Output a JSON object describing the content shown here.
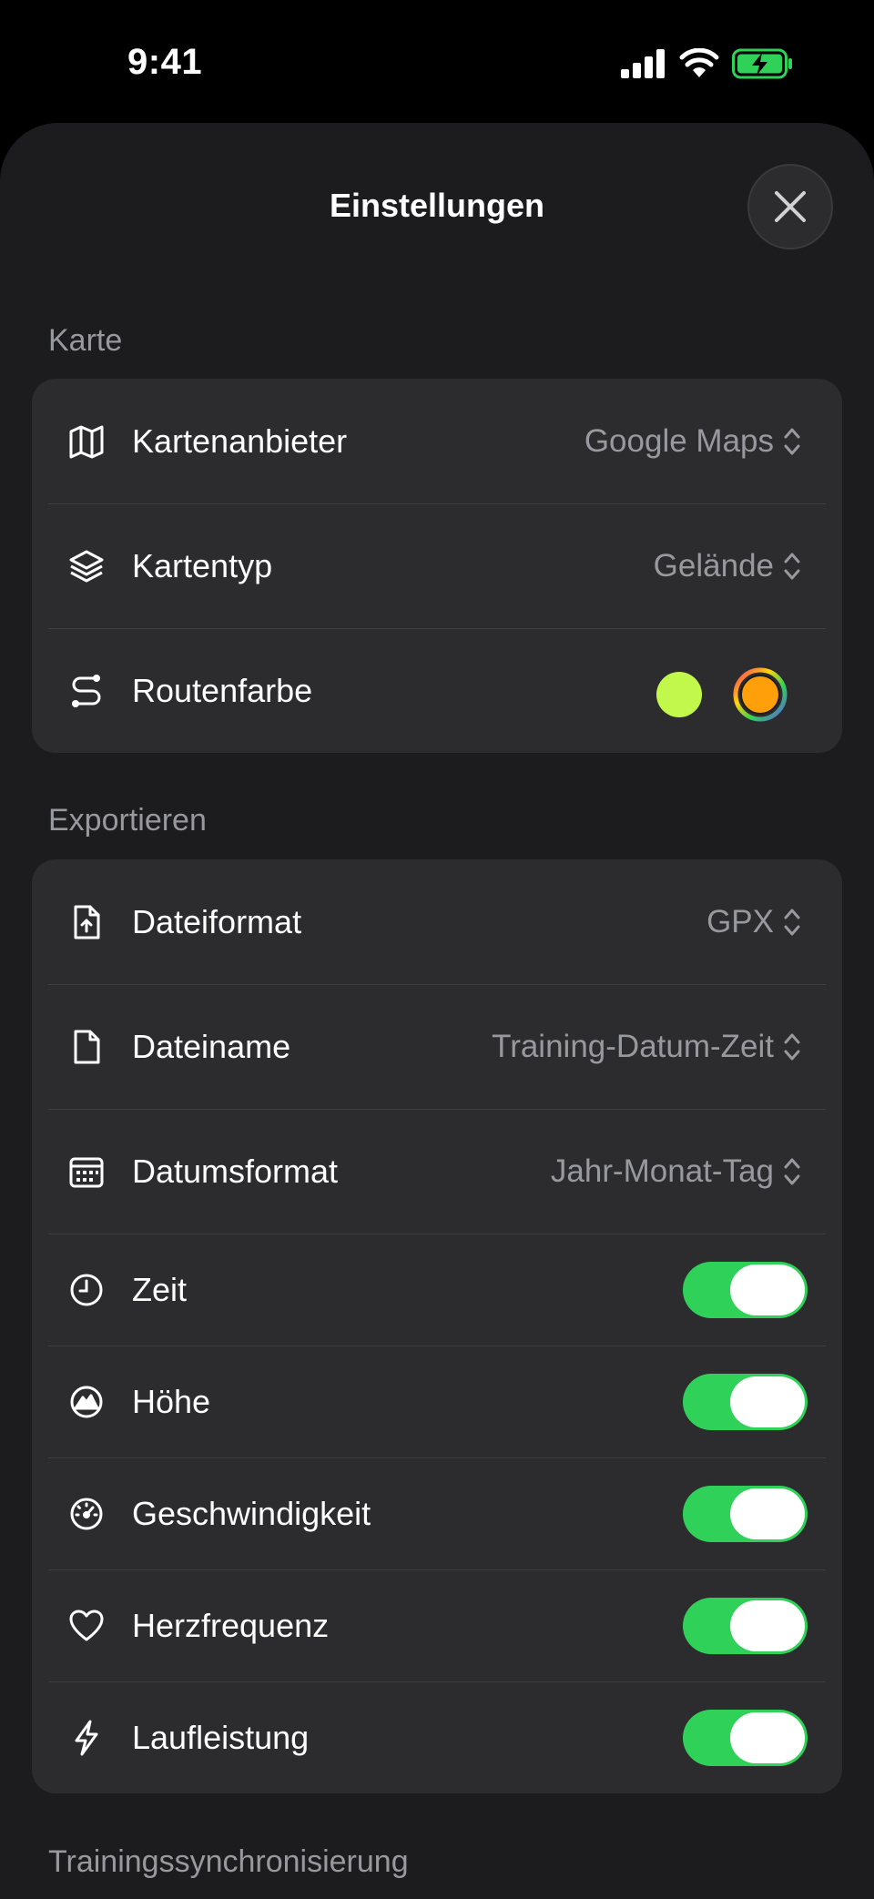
{
  "status": {
    "time": "9:41"
  },
  "header": {
    "title": "Einstellungen"
  },
  "sections": {
    "map": {
      "title": "Karte",
      "rows": [
        {
          "label": "Kartenanbieter",
          "value": "Google Maps",
          "icon": "map-icon"
        },
        {
          "label": "Kartentyp",
          "value": "Gelände",
          "icon": "layers-icon"
        },
        {
          "label": "Routenfarbe",
          "icon": "route-icon"
        }
      ],
      "route_colors": {
        "selected": "#c2f84c",
        "picker_fill": "#ff9f0a"
      }
    },
    "export": {
      "title": "Exportieren",
      "rows": [
        {
          "label": "Dateiformat",
          "value": "GPX",
          "icon": "file-export-icon"
        },
        {
          "label": "Dateiname",
          "value": "Training-Datum-Zeit",
          "icon": "document-icon"
        },
        {
          "label": "Datumsformat",
          "value": "Jahr-Monat-Tag",
          "icon": "calendar-icon"
        },
        {
          "label": "Zeit",
          "icon": "clock-icon",
          "toggle": true
        },
        {
          "label": "Höhe",
          "icon": "elevation-icon",
          "toggle": true
        },
        {
          "label": "Geschwindigkeit",
          "icon": "speedometer-icon",
          "toggle": true
        },
        {
          "label": "Herzfrequenz",
          "icon": "heart-icon",
          "toggle": true
        },
        {
          "label": "Laufleistung",
          "icon": "bolt-icon",
          "toggle": true
        }
      ]
    },
    "sync": {
      "title": "Trainingssynchronisierung"
    }
  },
  "colors": {
    "accent_toggle": "#30d158",
    "background": "#1c1c1e",
    "card": "#2c2c2e",
    "secondary_text": "#98989f"
  }
}
